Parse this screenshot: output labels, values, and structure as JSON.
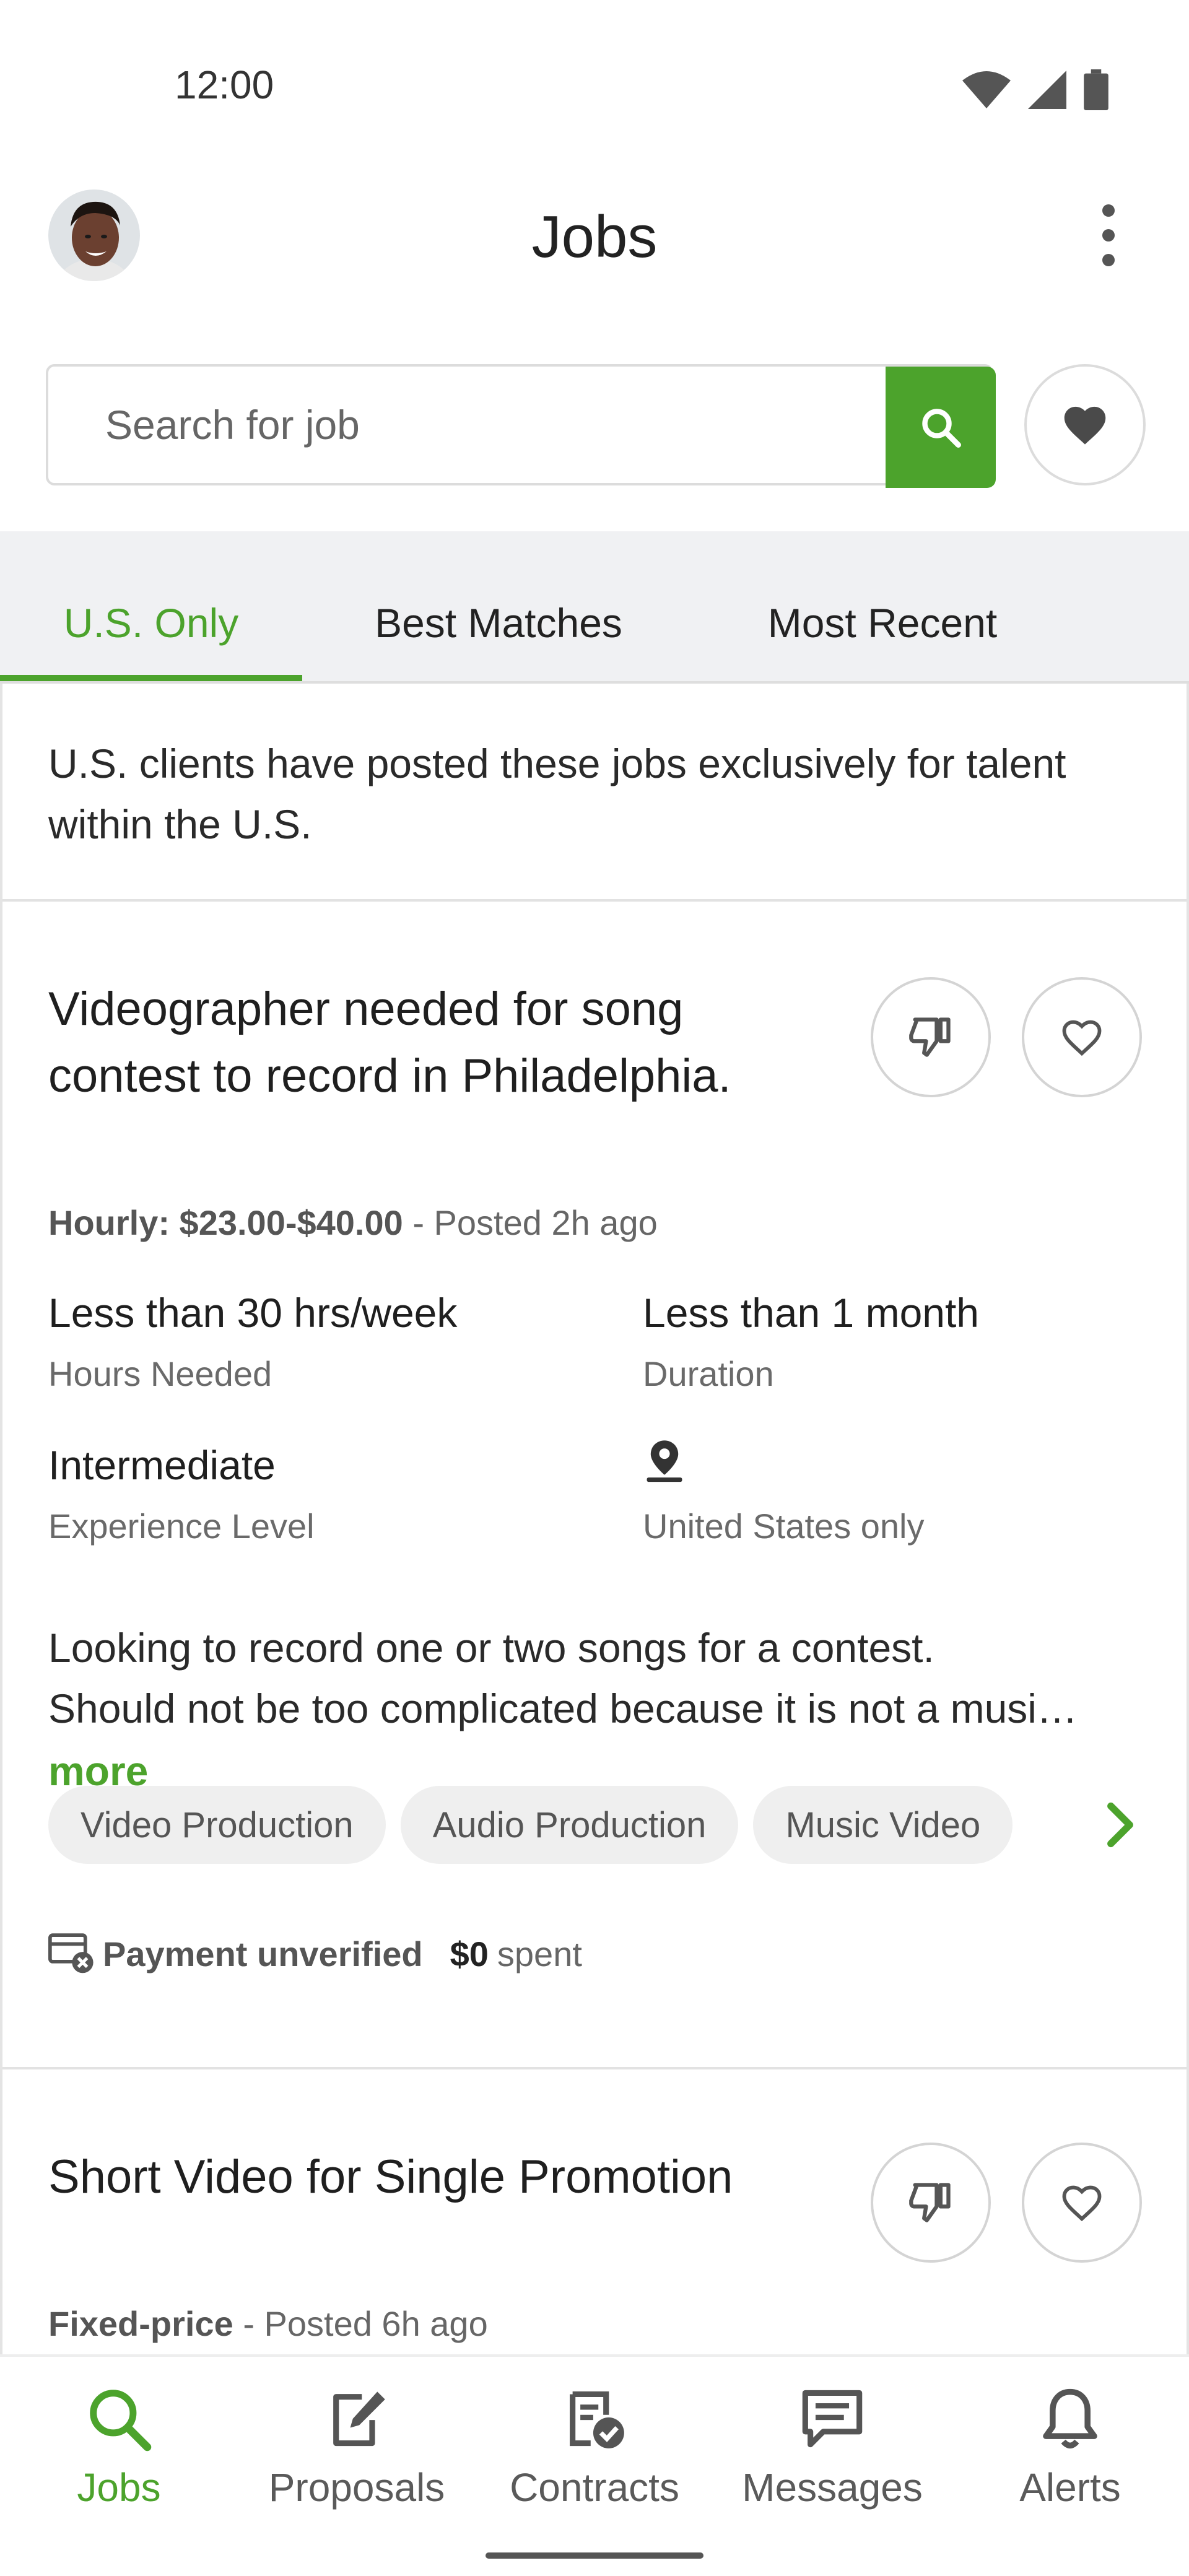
{
  "status_bar": {
    "time": "12:00",
    "icons": [
      "wifi-icon",
      "cell-signal-icon",
      "battery-icon"
    ]
  },
  "header": {
    "title": "Jobs",
    "avatar": "profile-avatar",
    "menu_icon": "more-vert-icon"
  },
  "search": {
    "placeholder": "Search for job",
    "button_icon": "search-icon",
    "saved_icon": "heart-filled-icon"
  },
  "tabs": [
    {
      "label": "U.S. Only",
      "active": true
    },
    {
      "label": "Best Matches",
      "active": false
    },
    {
      "label": "Most Recent",
      "active": false
    }
  ],
  "intro_text": "U.S. clients have posted these jobs exclusively for talent within the U.S.",
  "jobs": [
    {
      "title": "Videographer needed for song contest to record in Philadelphia.",
      "rate_type": "Hourly: $23.00-$40.00",
      "posted": " - Posted 2h ago",
      "details": [
        {
          "value": "Less than 30 hrs/week",
          "label": "Hours Needed"
        },
        {
          "value": "Less than 1 month",
          "label": "Duration"
        },
        {
          "value": "Intermediate",
          "label": "Experience Level"
        },
        {
          "value": "",
          "label": "United States only",
          "icon": "location-pin-icon"
        }
      ],
      "description_line1": "Looking to record one or two songs for a contest.",
      "description_line2": "Should not be too complicated because it is not a musi…",
      "more_label": "more",
      "skills": [
        "Video Production",
        "Audio Production",
        "Music Video"
      ],
      "payment_status": "Payment unverified",
      "spent_amount": "$0",
      "spent_label": "spent"
    },
    {
      "title": "Short Video for Single Promotion",
      "rate_type": "Fixed-price",
      "posted": " - Posted 6h ago"
    }
  ],
  "bottom_nav": [
    {
      "label": "Jobs",
      "icon": "search-icon",
      "active": true
    },
    {
      "label": "Proposals",
      "icon": "edit-document-icon",
      "active": false
    },
    {
      "label": "Contracts",
      "icon": "contract-check-icon",
      "active": false
    },
    {
      "label": "Messages",
      "icon": "message-icon",
      "active": false
    },
    {
      "label": "Alerts",
      "icon": "bell-icon",
      "active": false
    }
  ],
  "colors": {
    "accent": "#4ca32c",
    "tab_band": "#f0f1f3",
    "border": "#dcdcdc"
  }
}
